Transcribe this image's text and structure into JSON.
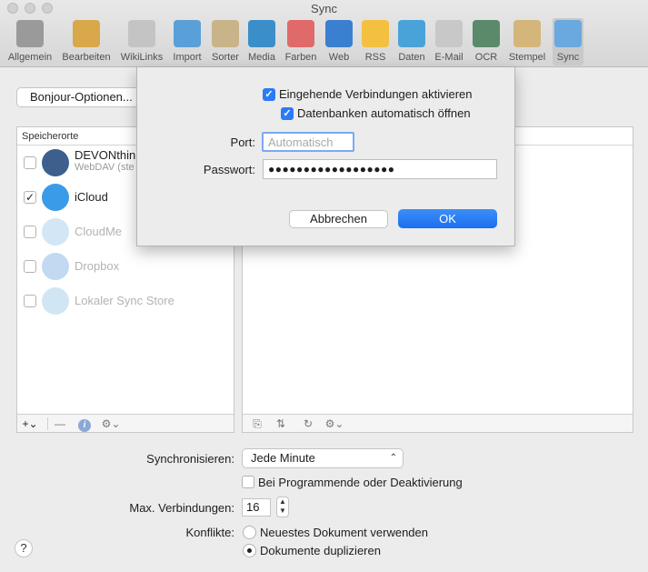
{
  "window": {
    "title": "Sync"
  },
  "toolbar": {
    "items": [
      {
        "label": "Allgemein",
        "icon": "switch-icon",
        "color": "#9a9a9a"
      },
      {
        "label": "Bearbeiten",
        "icon": "pencils-icon",
        "color": "#d9a84a"
      },
      {
        "label": "WikiLinks",
        "icon": "puzzle-icon",
        "color": "#c4c4c4"
      },
      {
        "label": "Import",
        "icon": "import-tray-icon",
        "color": "#5aa0d8"
      },
      {
        "label": "Sorter",
        "icon": "sorter-icon",
        "color": "#c9b48a"
      },
      {
        "label": "Media",
        "icon": "media-icon",
        "color": "#3a8fc8"
      },
      {
        "label": "Farben",
        "icon": "color-swatches-icon",
        "color": "#e06a6a"
      },
      {
        "label": "Web",
        "icon": "globe-icon",
        "color": "#3b7fd0"
      },
      {
        "label": "RSS",
        "icon": "rss-icon",
        "color": "#f3c040"
      },
      {
        "label": "Daten",
        "icon": "data-sheet-icon",
        "color": "#4aa3d8"
      },
      {
        "label": "E-Mail",
        "icon": "envelope-icon",
        "color": "#c8c8c8"
      },
      {
        "label": "OCR",
        "icon": "ocr-icon",
        "color": "#5a8a6a"
      },
      {
        "label": "Stempel",
        "icon": "stamp-icon",
        "color": "#d4b57a"
      },
      {
        "label": "Sync",
        "icon": "cloud-sync-icon",
        "color": "#6aa8e0"
      }
    ]
  },
  "main": {
    "bonjour_button": "Bonjour-Optionen...",
    "locations_header": "Speicherorte",
    "locations": [
      {
        "name": "DEVONthink",
        "subtitle": "WebDAV (ste",
        "checked": false,
        "dim": false,
        "icon": "devonthink-globe-icon"
      },
      {
        "name": "iCloud",
        "checked": true,
        "dim": false,
        "icon": "icloud-icon"
      },
      {
        "name": "CloudMe",
        "checked": false,
        "dim": true,
        "icon": "cloudme-icon"
      },
      {
        "name": "Dropbox",
        "checked": false,
        "dim": true,
        "icon": "dropbox-icon"
      },
      {
        "name": "Lokaler Sync Store",
        "checked": false,
        "dim": true,
        "icon": "local-store-icon"
      }
    ],
    "check_mark": "✓",
    "footer_add": "+⌄"
  },
  "settings": {
    "sync_label": "Synchronisieren:",
    "sync_value": "Jede Minute",
    "on_quit_label": "Bei Programmende oder Deaktivierung",
    "max_conn_label": "Max. Verbindungen:",
    "max_conn_value": "16",
    "conflicts_label": "Konflikte:",
    "conflict_options": [
      "Neuestes Dokument verwenden",
      "Dokumente duplizieren"
    ],
    "conflict_selected": 1
  },
  "dialog": {
    "incoming_label": "Eingehende Verbindungen aktivieren",
    "auto_open_label": "Datenbanken automatisch öffnen",
    "port_label": "Port:",
    "port_placeholder": "Automatisch",
    "password_label": "Passwort:",
    "password_value": "●●●●●●●●●●●●●●●●●●",
    "cancel_button": "Abbrechen",
    "ok_button": "OK"
  },
  "help_label": "?"
}
